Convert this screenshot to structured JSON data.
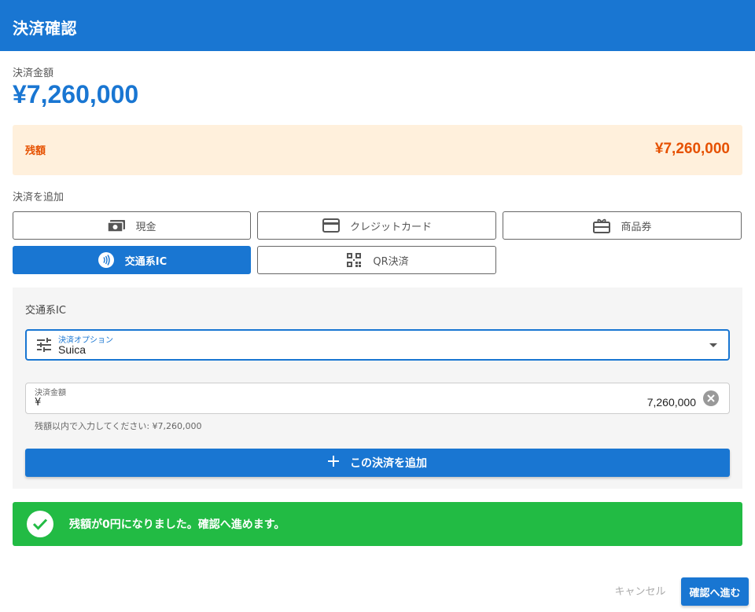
{
  "dialog": {
    "title": "決済確認"
  },
  "total": {
    "label": "決済金額",
    "value": "¥7,260,000"
  },
  "remaining": {
    "label": "残額",
    "value": "¥7,260,000"
  },
  "add_payment": {
    "label": "決済を追加",
    "methods": [
      {
        "label": "現金",
        "icon": "cash-icon",
        "active": false
      },
      {
        "label": "クレジットカード",
        "icon": "credit-card-icon",
        "active": false
      },
      {
        "label": "商品券",
        "icon": "gift-card-icon",
        "active": false
      },
      {
        "label": "交通系IC",
        "icon": "contactless-icon",
        "active": true
      },
      {
        "label": "QR決済",
        "icon": "qr-code-icon",
        "active": false
      }
    ]
  },
  "panel": {
    "title": "交通系IC",
    "option_field": {
      "label": "決済オプション",
      "value": "Suica",
      "icon": "tune-icon"
    },
    "amount_field": {
      "label": "決済金額",
      "prefix": "¥",
      "value": "7,260,000",
      "helper": "残額以内で入力してください: ¥7,260,000"
    },
    "add_button": "この決済を追加"
  },
  "success": {
    "message": "残額が0円になりました。確認へ進めます。"
  },
  "footer": {
    "cancel": "キャンセル",
    "confirm": "確認へ進む"
  },
  "colors": {
    "primary": "#1976d2",
    "warning_bg": "#fff0dc",
    "warning_text": "#e65100",
    "success": "#22bb44"
  }
}
